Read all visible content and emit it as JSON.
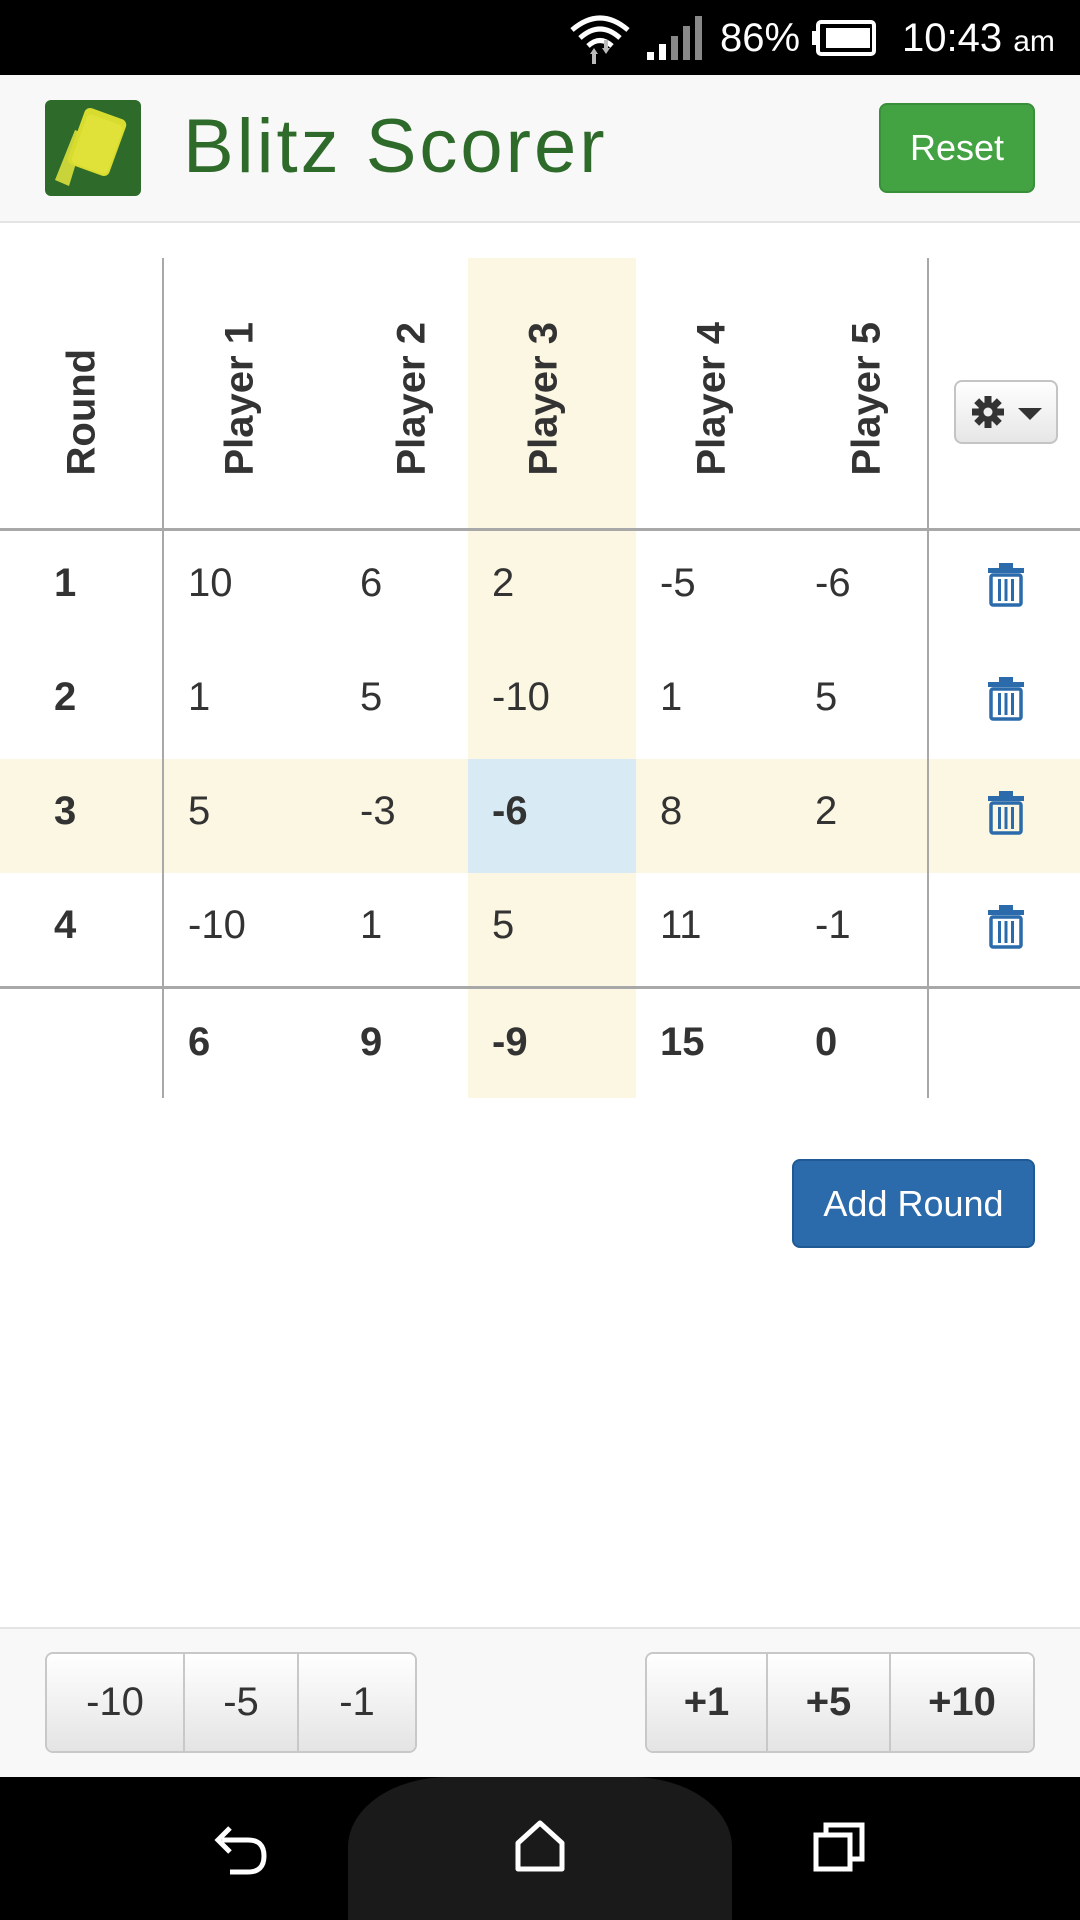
{
  "status_bar": {
    "battery_percent": "86%",
    "time": "10:43",
    "time_suffix": "am"
  },
  "header": {
    "title": "Blitz Scorer",
    "reset_label": "Reset",
    "logo_icon": "cards-logo-icon"
  },
  "table": {
    "round_header": "Round",
    "players": [
      "Player 1",
      "Player 2",
      "Player 3",
      "Player 4",
      "Player 5"
    ],
    "rows": [
      {
        "round": "1",
        "scores": [
          "10",
          "6",
          "2",
          "-5",
          "-6"
        ]
      },
      {
        "round": "2",
        "scores": [
          "1",
          "5",
          "-10",
          "1",
          "5"
        ]
      },
      {
        "round": "3",
        "scores": [
          "5",
          "-3",
          "-6",
          "8",
          "2"
        ]
      },
      {
        "round": "4",
        "scores": [
          "-10",
          "1",
          "5",
          "11",
          "-1"
        ]
      }
    ],
    "totals": [
      "6",
      "9",
      "-9",
      "15",
      "0"
    ],
    "highlighted_player": 3,
    "highlighted_round": 3
  },
  "add_round_label": "Add Round",
  "decrement_buttons": [
    "-10",
    "-5",
    "-1"
  ],
  "increment_buttons": [
    "+1",
    "+5",
    "+10"
  ],
  "colors": {
    "brand_green": "#2e6b2a",
    "reset_green": "#43a343",
    "primary_blue": "#2b6bab",
    "highlight_yellow": "#fcf7e2",
    "selected_blue": "#d8ebf5",
    "trash_blue": "#2b6bab"
  }
}
